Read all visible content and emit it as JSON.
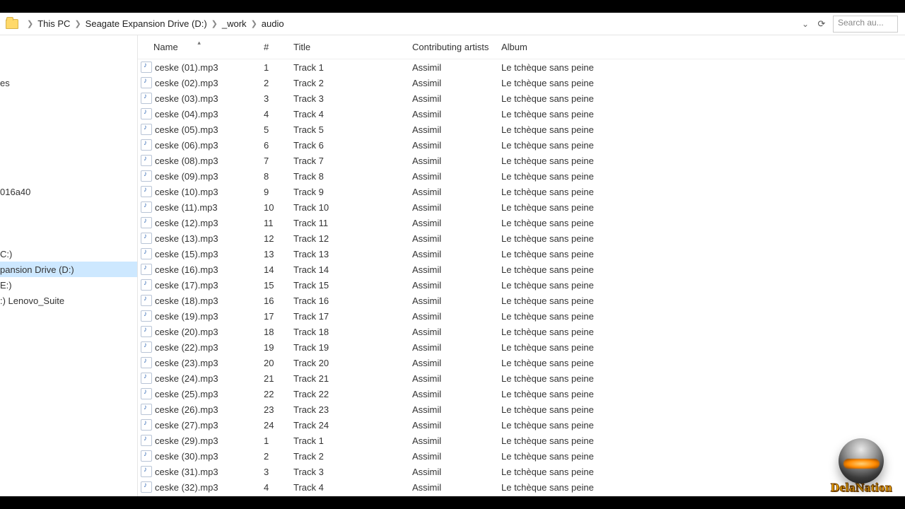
{
  "breadcrumb": [
    "This PC",
    "Seagate Expansion Drive (D:)",
    "_work",
    "audio"
  ],
  "search_placeholder": "Search au...",
  "columns": {
    "name": "Name",
    "num": "#",
    "title": "Title",
    "artist": "Contributing artists",
    "album": "Album"
  },
  "sort_indicator": "▴",
  "nav": [
    {
      "label": ""
    },
    {
      "label": "es"
    },
    {
      "label": ""
    },
    {
      "label": ""
    },
    {
      "label": ""
    },
    {
      "label": ""
    },
    {
      "label": ""
    },
    {
      "label": ""
    },
    {
      "label": "016a40"
    },
    {
      "label": ""
    },
    {
      "label": ""
    },
    {
      "label": ""
    },
    {
      "label": "C:)"
    },
    {
      "label": "pansion Drive (D:)",
      "selected": true
    },
    {
      "label": "E:)"
    },
    {
      "label": ":) Lenovo_Suite"
    }
  ],
  "files": [
    {
      "name": "ceske (01).mp3",
      "num": "1",
      "title": "Track  1",
      "artist": "Assimil",
      "album": "Le tchèque sans peine"
    },
    {
      "name": "ceske (02).mp3",
      "num": "2",
      "title": "Track  2",
      "artist": "Assimil",
      "album": "Le tchèque sans peine"
    },
    {
      "name": "ceske (03).mp3",
      "num": "3",
      "title": "Track  3",
      "artist": "Assimil",
      "album": "Le tchèque sans peine"
    },
    {
      "name": "ceske (04).mp3",
      "num": "4",
      "title": "Track  4",
      "artist": "Assimil",
      "album": "Le tchèque sans peine"
    },
    {
      "name": "ceske (05).mp3",
      "num": "5",
      "title": "Track  5",
      "artist": "Assimil",
      "album": "Le tchèque sans peine"
    },
    {
      "name": "ceske (06).mp3",
      "num": "6",
      "title": "Track  6",
      "artist": "Assimil",
      "album": "Le tchèque sans peine"
    },
    {
      "name": "ceske (08).mp3",
      "num": "7",
      "title": "Track  7",
      "artist": "Assimil",
      "album": "Le tchèque sans peine"
    },
    {
      "name": "ceske (09).mp3",
      "num": "8",
      "title": "Track  8",
      "artist": "Assimil",
      "album": "Le tchèque sans peine"
    },
    {
      "name": "ceske (10).mp3",
      "num": "9",
      "title": "Track  9",
      "artist": "Assimil",
      "album": "Le tchèque sans peine"
    },
    {
      "name": "ceske (11).mp3",
      "num": "10",
      "title": "Track 10",
      "artist": "Assimil",
      "album": "Le tchèque sans peine"
    },
    {
      "name": "ceske (12).mp3",
      "num": "11",
      "title": "Track 11",
      "artist": "Assimil",
      "album": "Le tchèque sans peine"
    },
    {
      "name": "ceske (13).mp3",
      "num": "12",
      "title": "Track 12",
      "artist": "Assimil",
      "album": "Le tchèque sans peine"
    },
    {
      "name": "ceske (15).mp3",
      "num": "13",
      "title": "Track 13",
      "artist": "Assimil",
      "album": "Le tchèque sans peine"
    },
    {
      "name": "ceske (16).mp3",
      "num": "14",
      "title": "Track 14",
      "artist": "Assimil",
      "album": "Le tchèque sans peine"
    },
    {
      "name": "ceske (17).mp3",
      "num": "15",
      "title": "Track 15",
      "artist": "Assimil",
      "album": "Le tchèque sans peine"
    },
    {
      "name": "ceske (18).mp3",
      "num": "16",
      "title": "Track 16",
      "artist": "Assimil",
      "album": "Le tchèque sans peine"
    },
    {
      "name": "ceske (19).mp3",
      "num": "17",
      "title": "Track 17",
      "artist": "Assimil",
      "album": "Le tchèque sans peine"
    },
    {
      "name": "ceske (20).mp3",
      "num": "18",
      "title": "Track 18",
      "artist": "Assimil",
      "album": "Le tchèque sans peine"
    },
    {
      "name": "ceske (22).mp3",
      "num": "19",
      "title": "Track 19",
      "artist": "Assimil",
      "album": "Le tchèque sans peine"
    },
    {
      "name": "ceske (23).mp3",
      "num": "20",
      "title": "Track 20",
      "artist": "Assimil",
      "album": "Le tchèque sans peine"
    },
    {
      "name": "ceske (24).mp3",
      "num": "21",
      "title": "Track 21",
      "artist": "Assimil",
      "album": "Le tchèque sans peine"
    },
    {
      "name": "ceske (25).mp3",
      "num": "22",
      "title": "Track 22",
      "artist": "Assimil",
      "album": "Le tchèque sans peine"
    },
    {
      "name": "ceske (26).mp3",
      "num": "23",
      "title": "Track 23",
      "artist": "Assimil",
      "album": "Le tchèque sans peine"
    },
    {
      "name": "ceske (27).mp3",
      "num": "24",
      "title": "Track 24",
      "artist": "Assimil",
      "album": "Le tchèque sans peine"
    },
    {
      "name": "ceske (29).mp3",
      "num": "1",
      "title": "Track  1",
      "artist": "Assimil",
      "album": "Le tchèque sans peine"
    },
    {
      "name": "ceske (30).mp3",
      "num": "2",
      "title": "Track  2",
      "artist": "Assimil",
      "album": "Le tchèque sans peine"
    },
    {
      "name": "ceske (31).mp3",
      "num": "3",
      "title": "Track  3",
      "artist": "Assimil",
      "album": "Le tchèque sans peine"
    },
    {
      "name": "ceske (32).mp3",
      "num": "4",
      "title": "Track  4",
      "artist": "Assimil",
      "album": "Le tchèque sans peine"
    }
  ],
  "watermark": "DelaNation"
}
